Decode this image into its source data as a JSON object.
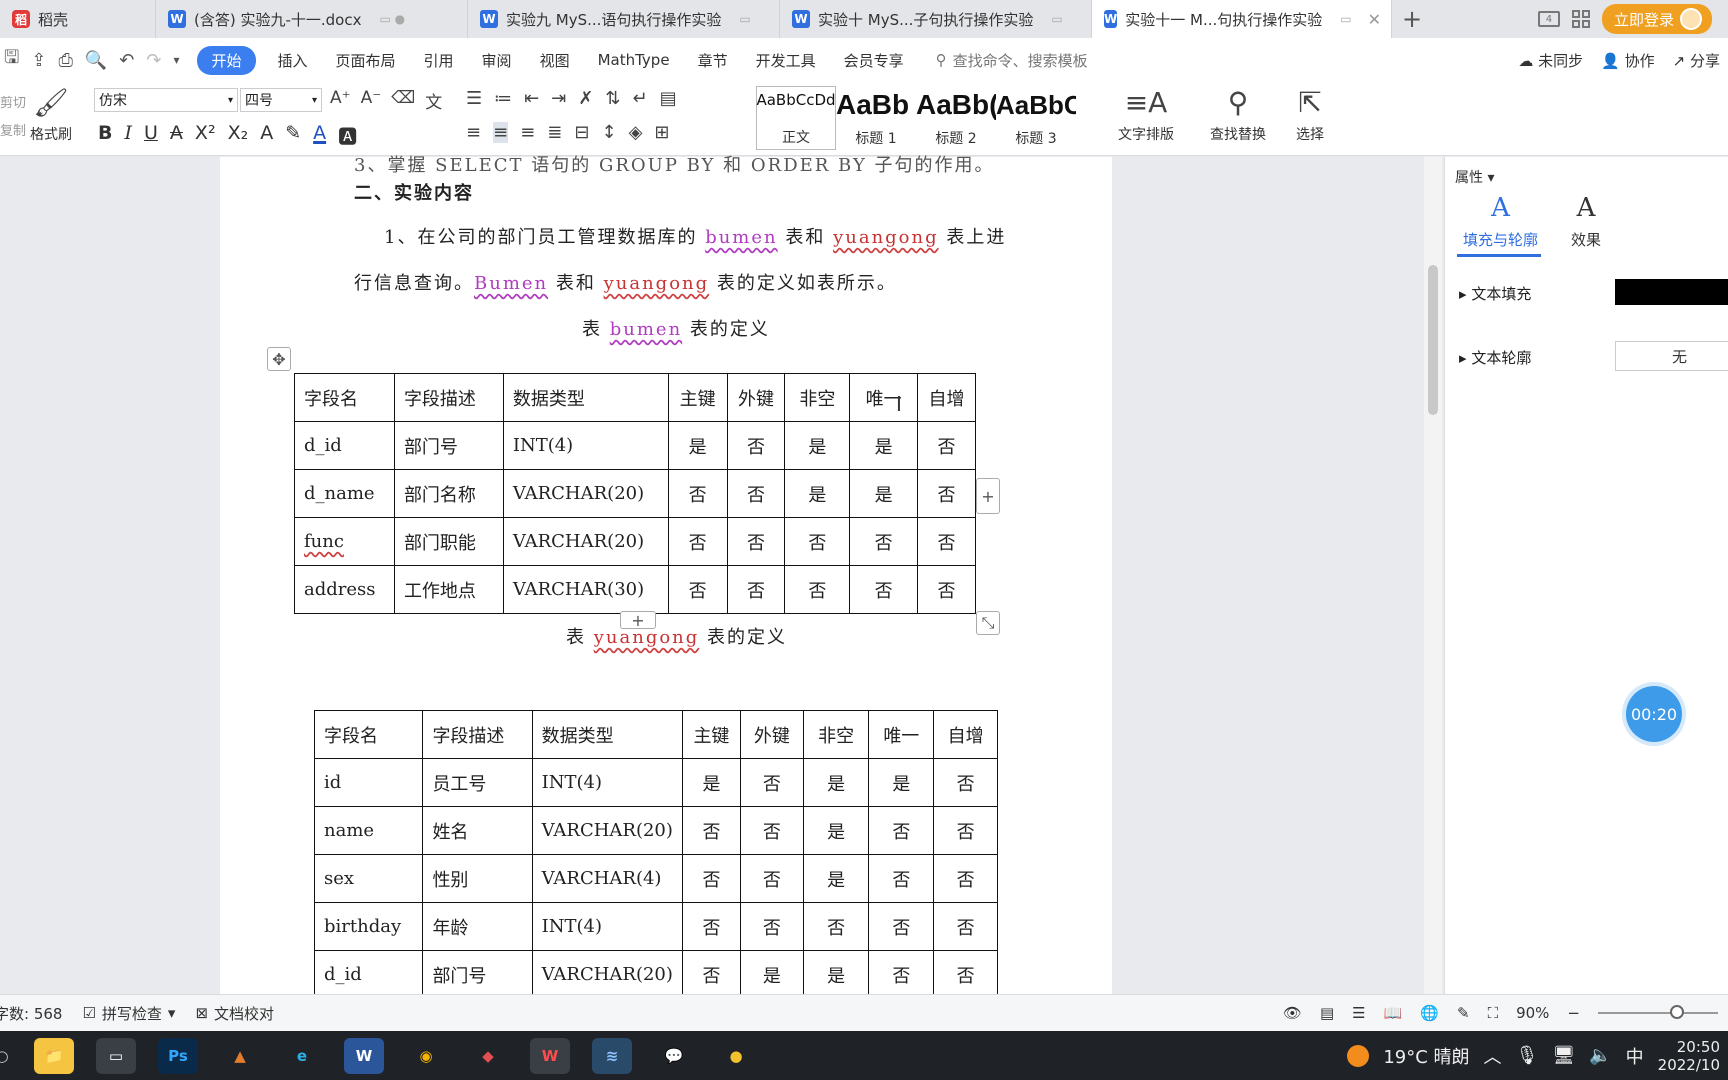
{
  "tabs": [
    {
      "label": "稻壳",
      "icon": "docer-icon",
      "active": false
    },
    {
      "label": "(含答) 实验九-十一.docx",
      "icon": "word-doc-icon",
      "active": false
    },
    {
      "label": "实验九  MyS...语句执行操作实验",
      "icon": "word-doc-icon",
      "active": false
    },
    {
      "label": "实验十  MyS...子句执行操作实验",
      "icon": "word-doc-icon",
      "active": false
    },
    {
      "label": "实验十一  M...句执行操作实验",
      "icon": "word-doc-icon",
      "active": true
    }
  ],
  "titlebar": {
    "login_label": "立即登录",
    "window_badge": "4"
  },
  "menu": {
    "items": [
      "开始",
      "插入",
      "页面布局",
      "引用",
      "审阅",
      "视图",
      "MathType",
      "章节",
      "开发工具",
      "会员专享"
    ],
    "active_index": 0,
    "search_placeholder": "查找命令、搜索模板",
    "right": [
      "未同步",
      "协作",
      "分享"
    ]
  },
  "ribbon": {
    "clip_labels": [
      "剪切",
      "复制"
    ],
    "format_painter": "格式刷",
    "font_name": "仿宋",
    "font_size": "四号",
    "styles": [
      {
        "preview": "AaBbCcDd",
        "name": "正文"
      },
      {
        "preview": "AaBb",
        "name": "标题 1"
      },
      {
        "preview": "AaBb(",
        "name": "标题 2"
      },
      {
        "preview": "AaBbC",
        "name": "标题 3"
      }
    ],
    "text_layout": "文字排版",
    "find_replace": "查找替换",
    "select": "选择"
  },
  "document": {
    "line1": "3、掌握 SELECT 语句的 GROUP BY  和 ORDER BY 子句的作用。",
    "heading2": "二、实验内容",
    "para1_a": "1、在公司的部门员工管理数据库的 ",
    "para1_b": "bumen",
    "para1_c": " 表和 ",
    "para1_d": "yuangong",
    "para1_e": " 表上进",
    "para2_a": "行信息查询。",
    "para2_b": "Bumen",
    "para2_c": " 表和 ",
    "para2_d": "yuangong",
    "para2_e": " 表的定义如表所示。",
    "caption1_a": "表 ",
    "caption1_b": "bumen",
    "caption1_c": " 表的定义",
    "caption2_a": "表 ",
    "caption2_b": "yuangong",
    "caption2_c": " 表的定义"
  },
  "table_bumen": {
    "headers": [
      "字段名",
      "字段描述",
      "数据类型",
      "主键",
      "外键",
      "非空",
      "唯一",
      "自增"
    ],
    "rows": [
      [
        "d_id",
        "部门号",
        "INT(4)",
        "是",
        "否",
        "是",
        "是",
        "否"
      ],
      [
        "d_name",
        "部门名称",
        "VARCHAR(20)",
        "否",
        "否",
        "是",
        "是",
        "否"
      ],
      [
        "func",
        "部门职能",
        "VARCHAR(20)",
        "否",
        "否",
        "否",
        "否",
        "否"
      ],
      [
        "address",
        "工作地点",
        "VARCHAR(30)",
        "否",
        "否",
        "否",
        "否",
        "否"
      ]
    ]
  },
  "table_yuangong": {
    "headers": [
      "字段名",
      "字段描述",
      "数据类型",
      "主键",
      "外键",
      "非空",
      "唯一",
      "自增"
    ],
    "rows": [
      [
        "id",
        "员工号",
        "INT(4)",
        "是",
        "否",
        "是",
        "是",
        "否"
      ],
      [
        "name",
        "姓名",
        "VARCHAR(20)",
        "否",
        "否",
        "是",
        "否",
        "否"
      ],
      [
        "sex",
        "性别",
        "VARCHAR(4)",
        "否",
        "否",
        "是",
        "否",
        "否"
      ],
      [
        "birthday",
        "年龄",
        "INT(4)",
        "否",
        "否",
        "否",
        "否",
        "否"
      ],
      [
        "d_id",
        "部门号",
        "VARCHAR(20)",
        "否",
        "是",
        "是",
        "否",
        "否"
      ]
    ]
  },
  "side_panel": {
    "title": "属性",
    "tab_fill": "填充与轮廓",
    "tab_effect": "效果",
    "text_fill": "文本填充",
    "text_outline": "文本轮廓",
    "outline_value": "无",
    "fill_color": "#000000"
  },
  "timer": "00:20",
  "status": {
    "word_count": "字数: 568",
    "spell_check": "拼写检查",
    "doc_proof": "文档校对",
    "zoom": "90%"
  },
  "taskbar": {
    "weather": "19°C  晴朗",
    "ime": "中",
    "time": "20:50",
    "date": "2022/10"
  },
  "colors": {
    "accent": "#3b7ef0",
    "login": "#f0a020",
    "spell_red": "#c83232",
    "spell_pink": "#b03cc0"
  }
}
